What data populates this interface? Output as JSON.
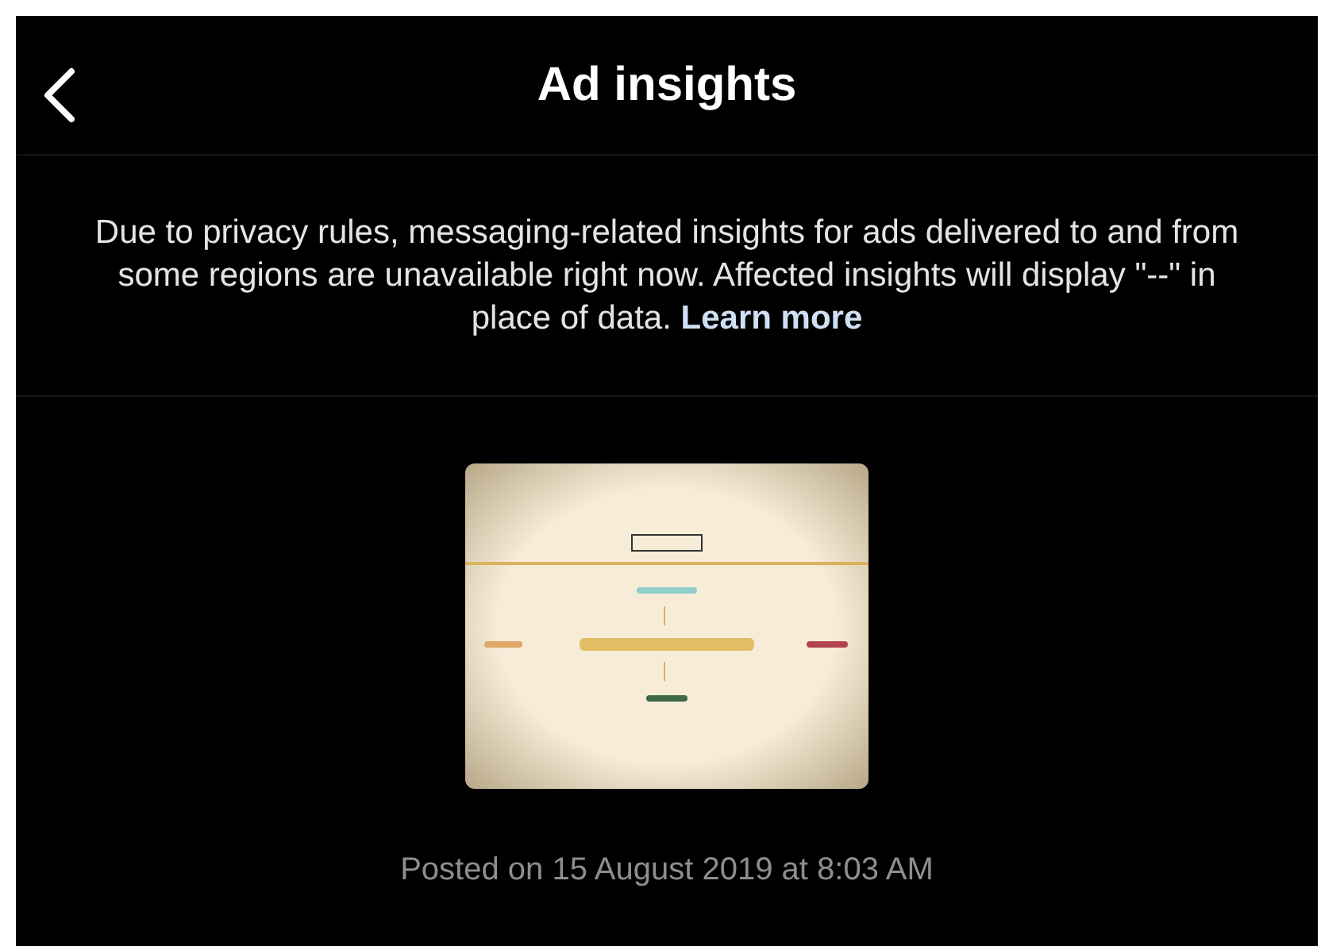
{
  "header": {
    "title": "Ad insights"
  },
  "notice": {
    "text": "Due to privacy rules, messaging-related insights for ads delivered to and from some regions are unavailable right now. Affected insights will display \"--\" in place of data.",
    "link": "Learn more"
  },
  "ad": {
    "posted": "Posted on 15 August 2019 at 8:03 AM"
  }
}
